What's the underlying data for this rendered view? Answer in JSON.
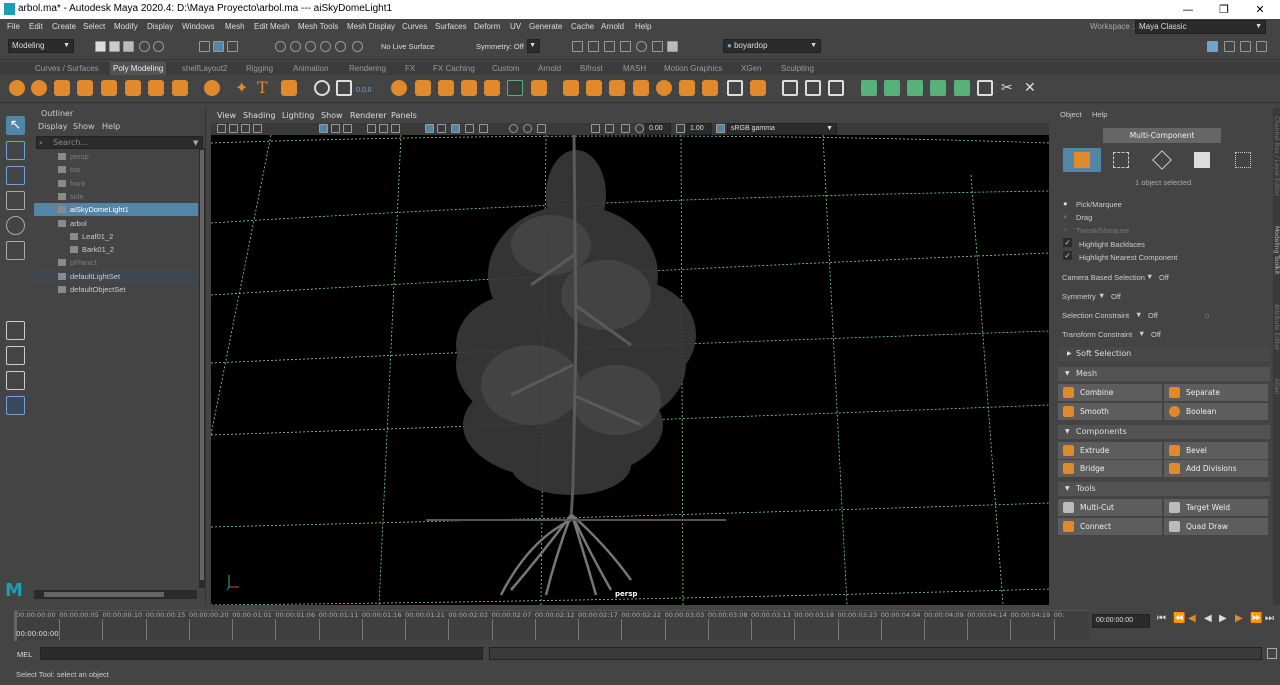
{
  "window": {
    "title": "arbol.ma* - Autodesk Maya 2020.4: D:\\Maya Proyecto\\arbol.ma   ---   aiSkyDomeLight1",
    "minimize": "—",
    "maximize": "❐",
    "close": "✕"
  },
  "menubar": [
    "File",
    "Edit",
    "Create",
    "Select",
    "Modify",
    "Display",
    "Windows",
    "Mesh",
    "Edit Mesh",
    "Mesh Tools",
    "Mesh Display",
    "Curves",
    "Surfaces",
    "Deform",
    "UV",
    "Generate",
    "Cache",
    "Arnold",
    "Help"
  ],
  "workspace": {
    "label": "Workspace :",
    "value": "Maya Classic"
  },
  "statusline": {
    "mode": "Modeling",
    "live_surface": "No Live Surface",
    "symmetry": "Symmetry: Off",
    "user": "boyardop"
  },
  "shelf_tabs": [
    "Curves / Surfaces",
    "Poly Modeling",
    "shelfLayout2",
    "Rigging",
    "Animation",
    "Rendering",
    "FX",
    "FX Caching",
    "Custom",
    "Arnold",
    "Bifrost",
    "MASH",
    "Motion Graphics",
    "XGen",
    "Sculpting"
  ],
  "shelf_active": "Poly Modeling",
  "shelf_value": "0.0,0",
  "outliner": {
    "title": "Outliner",
    "menu": [
      "Display",
      "Show",
      "Help"
    ],
    "search_placeholder": "Search...",
    "rows": [
      {
        "label": "persp",
        "state": "dim",
        "indent": 0
      },
      {
        "label": "top",
        "state": "dim",
        "indent": 0
      },
      {
        "label": "front",
        "state": "dim",
        "indent": 0
      },
      {
        "label": "side",
        "state": "dim",
        "indent": 0
      },
      {
        "label": "aiSkyDomeLight1",
        "state": "selected",
        "indent": 0
      },
      {
        "label": "arbol",
        "state": "normal",
        "indent": 0
      },
      {
        "label": "Leaf01_2",
        "state": "normal",
        "indent": 1
      },
      {
        "label": "Bark01_2",
        "state": "normal",
        "indent": 1
      },
      {
        "label": "pPlane1",
        "state": "dim",
        "indent": 0
      },
      {
        "label": "defaultLightSet",
        "state": "group",
        "indent": 0
      },
      {
        "label": "defaultObjectSet",
        "state": "normal",
        "indent": 0
      }
    ]
  },
  "viewport": {
    "menu": [
      "View",
      "Shading",
      "Lighting",
      "Show",
      "Renderer",
      "Panels"
    ],
    "value_a": "0.00",
    "value_b": "1.00",
    "color_space": "sRGB gamma",
    "camera_label": "persp"
  },
  "modeling_toolkit": {
    "menu": [
      "Object",
      "Help"
    ],
    "mode": "Multi-Component",
    "selection_info": "1 object selected",
    "pick_options": [
      {
        "label": "Pick/Marquee",
        "enabled": true
      },
      {
        "label": "Drag",
        "enabled": true
      },
      {
        "label": "Tweak/Marquee",
        "enabled": false
      }
    ],
    "checks": [
      "Highlight Backfaces",
      "Highlight Nearest Component"
    ],
    "settings": [
      {
        "label": "Camera Based Selection",
        "value": "Off"
      },
      {
        "label": "Symmetry",
        "value": "Off"
      },
      {
        "label": "Selection Constraint",
        "value": "Off",
        "extra": "0"
      },
      {
        "label": "Transform Constraint",
        "value": "Off"
      }
    ],
    "soft_selection": "Soft Selection",
    "sections": [
      {
        "title": "Mesh",
        "buttons": [
          "Combine",
          "Separate",
          "Smooth",
          "Boolean"
        ]
      },
      {
        "title": "Components",
        "buttons": [
          "Extrude",
          "Bevel",
          "Bridge",
          "Add Divisions"
        ]
      },
      {
        "title": "Tools",
        "buttons": [
          "Multi-Cut",
          "Target Weld",
          "Connect",
          "Quad Draw"
        ]
      }
    ]
  },
  "side_strip": [
    "Channel Box / Layer Editor",
    "Modeling Toolkit",
    "Attribute Editor",
    "XGen"
  ],
  "timeline": {
    "ticks": [
      "00:00:00:00",
      "00:00:00:05",
      "00:00:00:10",
      "00:00:00:15",
      "00:00:00:20",
      "00:00:01:01",
      "00:00:01:06",
      "00:00:01:11",
      "00:00:01:16",
      "00:00:01:21",
      "00:00:02:02",
      "00:00:02:07",
      "00:00:02:12",
      "00:00:02:17",
      "00:00:02:22",
      "00:00:03:03",
      "00:00:03:08",
      "00:00:03:13",
      "00:00:03:18",
      "00:00:03:23",
      "00:00:04:04",
      "00:00:04:09",
      "00:00:04:14",
      "00:00:04:19",
      "00:"
    ],
    "current": "00:00:00:00",
    "current_field": "00:00:00:00"
  },
  "command_line": {
    "label": "MEL"
  },
  "help_line": "Select Tool: select an object"
}
